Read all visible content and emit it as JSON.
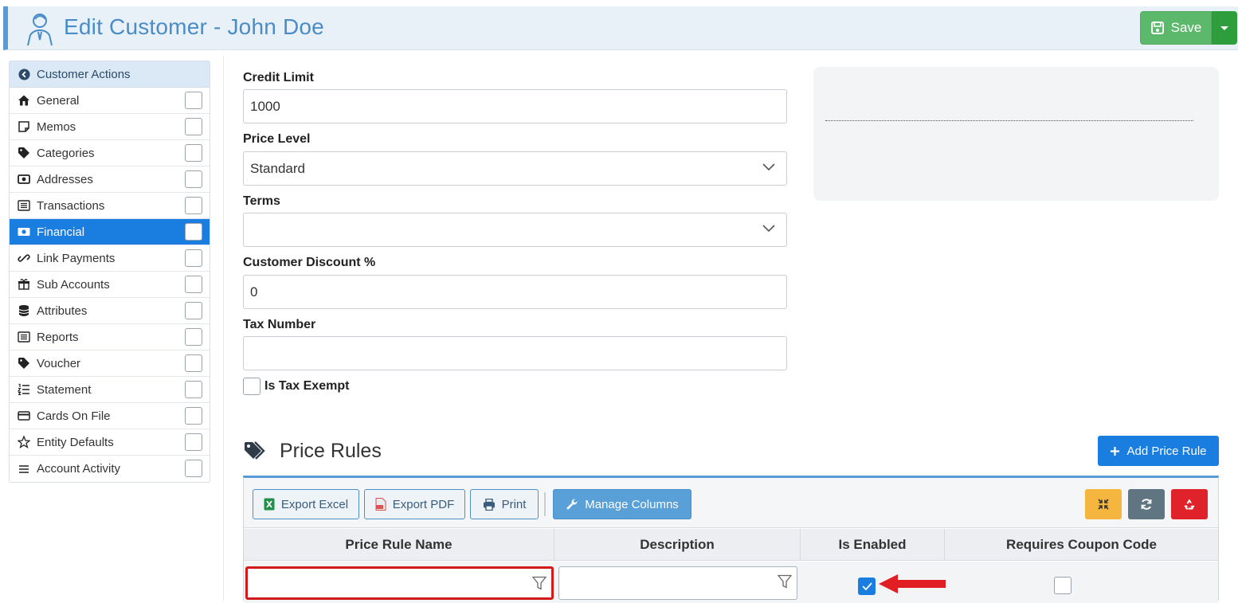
{
  "header": {
    "title": "Edit Customer - John Doe",
    "save_label": "Save",
    "colors": {
      "accent": "#4a8cc7",
      "save": "#5cb86a"
    }
  },
  "sidebar": {
    "heading": "Customer Actions",
    "items": [
      {
        "label": "General",
        "icon": "home-icon",
        "active": false
      },
      {
        "label": "Memos",
        "icon": "note-icon",
        "active": false
      },
      {
        "label": "Categories",
        "icon": "tag-icon",
        "active": false
      },
      {
        "label": "Addresses",
        "icon": "address-card-icon",
        "active": false
      },
      {
        "label": "Transactions",
        "icon": "list-icon",
        "active": false
      },
      {
        "label": "Financial",
        "icon": "money-icon",
        "active": true
      },
      {
        "label": "Link Payments",
        "icon": "link-icon",
        "active": false
      },
      {
        "label": "Sub Accounts",
        "icon": "gift-icon",
        "active": false
      },
      {
        "label": "Attributes",
        "icon": "database-icon",
        "active": false
      },
      {
        "label": "Reports",
        "icon": "list-icon",
        "active": false
      },
      {
        "label": "Voucher",
        "icon": "tag-icon",
        "active": false
      },
      {
        "label": "Statement",
        "icon": "ordered-list-icon",
        "active": false
      },
      {
        "label": "Cards On File",
        "icon": "credit-card-icon",
        "active": false
      },
      {
        "label": "Entity Defaults",
        "icon": "star-icon",
        "active": false
      },
      {
        "label": "Account Activity",
        "icon": "menu-icon",
        "active": false
      }
    ]
  },
  "form": {
    "credit_limit": {
      "label": "Credit Limit",
      "value": "1000"
    },
    "price_level": {
      "label": "Price Level",
      "value": "Standard"
    },
    "terms": {
      "label": "Terms",
      "value": ""
    },
    "customer_discount": {
      "label": "Customer Discount %",
      "value": "0"
    },
    "tax_number": {
      "label": "Tax Number",
      "value": ""
    },
    "is_tax_exempt": {
      "label": "Is Tax Exempt",
      "checked": false
    }
  },
  "price_rules": {
    "title": "Price Rules",
    "add_label": "Add Price Rule",
    "toolbar": {
      "export_excel": "Export Excel",
      "export_pdf": "Export PDF",
      "print": "Print",
      "manage_columns": "Manage Columns"
    },
    "columns": [
      "Price Rule Name",
      "Description",
      "Is Enabled",
      "Requires Coupon Code"
    ],
    "filter": {
      "name": "",
      "description": "",
      "is_enabled": true,
      "requires_coupon": false
    }
  }
}
